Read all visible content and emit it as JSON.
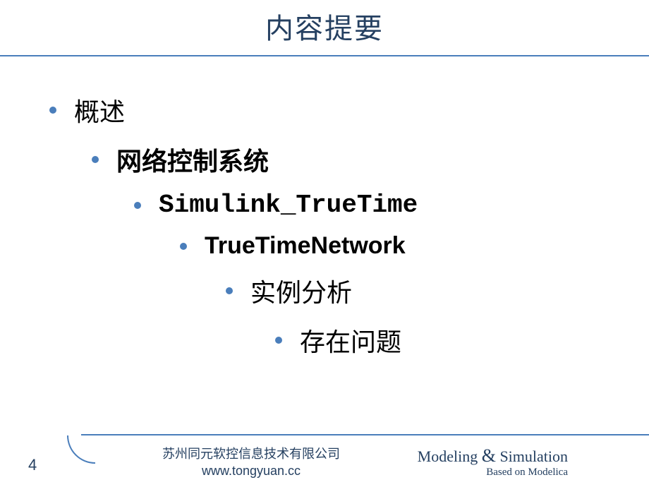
{
  "header": {
    "title": "内容提要"
  },
  "bullets": {
    "item1": "概述",
    "item2": "网络控制系统",
    "item3": "Simulink_TrueTime",
    "item4": "TrueTimeNetwork",
    "item5": "实例分析",
    "item6": "存在问题"
  },
  "footer": {
    "pageNumber": "4",
    "companyName": "苏州同元软控信息技术有限公司",
    "companyUrl": "www.tongyuan.cc",
    "tagline1a": "Modeling ",
    "tagline1amp": "&",
    "tagline1b": " Simulation",
    "tagline2": "Based on Modelica"
  }
}
